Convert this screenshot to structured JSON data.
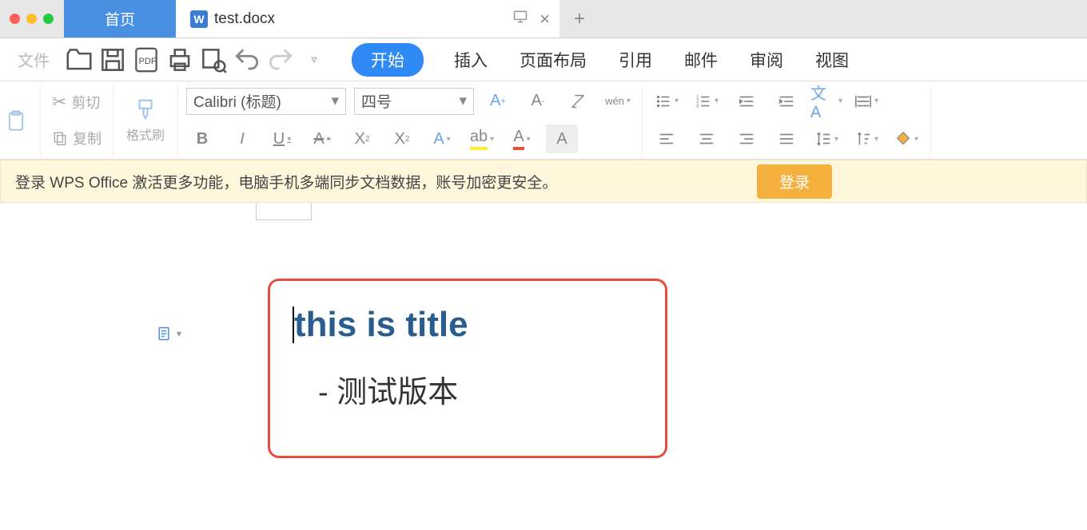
{
  "titlebar": {
    "home_tab": "首页",
    "doc_tab": "test.docx",
    "present_icon": "presentation-icon",
    "close_icon": "close-icon",
    "new_tab": "+"
  },
  "menubar": {
    "file_label": "文件",
    "tabs": {
      "start": "开始",
      "insert": "插入",
      "layout": "页面布局",
      "reference": "引用",
      "mail": "邮件",
      "review": "审阅",
      "view": "视图"
    }
  },
  "ribbon": {
    "cut": "剪切",
    "copy": "复制",
    "format_painter": "格式刷",
    "font_name": "Calibri (标题)",
    "font_size": "四号"
  },
  "banner": {
    "text": "登录 WPS Office 激活更多功能，电脑手机多端同步文档数据，账号加密更安全。",
    "login": "登录"
  },
  "document": {
    "title": "this is title",
    "subtitle": "- 测试版本"
  }
}
